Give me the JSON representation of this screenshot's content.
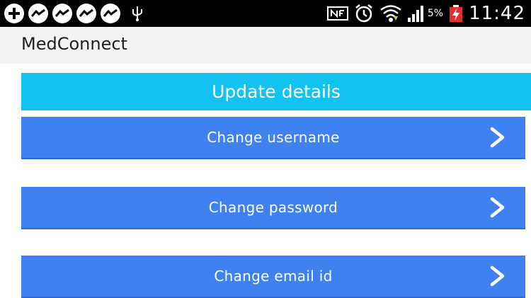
{
  "status_bar": {
    "battery_percent": "5%",
    "time": "11:42",
    "left_icons": [
      "add-notification-icon",
      "messenger-icon",
      "messenger-icon",
      "messenger-icon",
      "messenger-icon",
      "usb-icon"
    ],
    "right_icons": [
      "nfc-icon",
      "alarm-icon",
      "wifi-icon",
      "signal-icon",
      "battery-charging-icon"
    ]
  },
  "app": {
    "title": "MedConnect"
  },
  "banner": {
    "title": "Update details"
  },
  "menu": {
    "items": [
      {
        "label": "Change username",
        "icon": "chevron-right-icon"
      },
      {
        "label": "Change password",
        "icon": "chevron-right-icon"
      },
      {
        "label": "Change email id",
        "icon": "chevron-right-icon"
      }
    ]
  },
  "colors": {
    "status_bar": "#000000",
    "action_bar": "#f3f3f3",
    "banner": "#12c2f0",
    "button": "#3f81f0",
    "text_on_color": "#ffffff"
  }
}
